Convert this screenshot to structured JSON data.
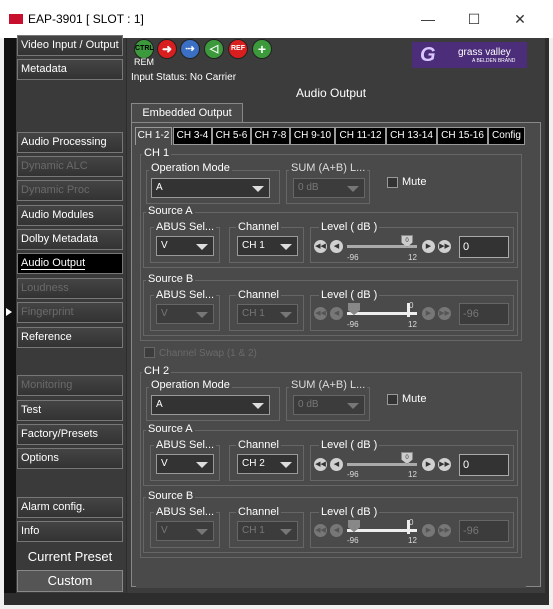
{
  "window": {
    "title": "EAP-3901 [ SLOT : 1]",
    "min": "—",
    "max": "☐",
    "close": "✕"
  },
  "sidebar": {
    "items": [
      {
        "label": "Video Input / Output",
        "state": "normal"
      },
      {
        "label": "Metadata",
        "state": "normal"
      },
      {
        "label": "Audio Processing",
        "state": "normal"
      },
      {
        "label": "Dynamic ALC",
        "state": "disabled"
      },
      {
        "label": "Dynamic Proc",
        "state": "disabled"
      },
      {
        "label": "Audio Modules",
        "state": "normal"
      },
      {
        "label": "Dolby Metadata",
        "state": "normal"
      },
      {
        "label": "Audio Output",
        "state": "selected"
      },
      {
        "label": "Loudness",
        "state": "disabled"
      },
      {
        "label": "Fingerprint",
        "state": "disabled"
      },
      {
        "label": "Reference",
        "state": "normal"
      },
      {
        "label": "Monitoring",
        "state": "disabled"
      },
      {
        "label": "Test",
        "state": "normal"
      },
      {
        "label": "Factory/Presets",
        "state": "normal"
      },
      {
        "label": "Options",
        "state": "normal"
      },
      {
        "label": "Alarm config.",
        "state": "normal"
      },
      {
        "label": "Info",
        "state": "normal"
      }
    ],
    "current_preset": "Current Preset",
    "preset_value": "Custom"
  },
  "toolbar": {
    "icons": [
      "ctrl-icon",
      "arrow-icon",
      "transfer-icon",
      "audio-icon",
      "ref-icon",
      "add-icon"
    ],
    "ctrl_label": "CTRL",
    "ref_label": "REF",
    "rem_label": "REM"
  },
  "brand": {
    "name": "grass valley",
    "sub": "A BELDEN BRAND"
  },
  "status": "Input Status: No Carrier",
  "heading": "Audio Output",
  "embedded_tab": "Embedded Output",
  "channel_tabs": [
    "CH 1-2",
    "CH 3-4",
    "CH 5-6",
    "CH 7-8",
    "CH 9-10",
    "CH 11-12",
    "CH 13-14",
    "CH 15-16",
    "Config"
  ],
  "ch1": {
    "title": "CH 1",
    "op_mode_label": "Operation Mode",
    "op_mode": "A",
    "sum_label": "SUM (A+B) L...",
    "sum_value": "0 dB",
    "mute_label": "Mute",
    "source_a": {
      "title": "Source A",
      "abus_label": "ABUS Sel...",
      "abus": "V",
      "channel_label": "Channel",
      "channel": "CH 1",
      "level_label": "Level ( dB )",
      "min": "-96",
      "max": "12",
      "value": "0"
    },
    "source_b": {
      "title": "Source B",
      "abus_label": "ABUS Sel...",
      "abus": "V",
      "channel_label": "Channel",
      "channel": "CH 1",
      "level_label": "Level ( dB )",
      "min": "-96",
      "max": "12",
      "zero": "0",
      "value": "-96"
    }
  },
  "swap_label": "Channel Swap (1 & 2)",
  "ch2": {
    "title": "CH 2",
    "op_mode_label": "Operation Mode",
    "op_mode": "A",
    "sum_label": "SUM (A+B) L...",
    "sum_value": "0 dB",
    "mute_label": "Mute",
    "source_a": {
      "title": "Source A",
      "abus_label": "ABUS Sel...",
      "abus": "V",
      "channel_label": "Channel",
      "channel": "CH 2",
      "level_label": "Level ( dB )",
      "min": "-96",
      "max": "12",
      "value": "0"
    },
    "source_b": {
      "title": "Source B",
      "abus_label": "ABUS Sel...",
      "abus": "V",
      "channel_label": "Channel",
      "channel": "CH 1",
      "level_label": "Level ( dB )",
      "min": "-96",
      "max": "12",
      "zero": "0",
      "value": "-96"
    }
  },
  "colors": {
    "accent": "#c8102e",
    "brand": "#4b2d7a"
  }
}
